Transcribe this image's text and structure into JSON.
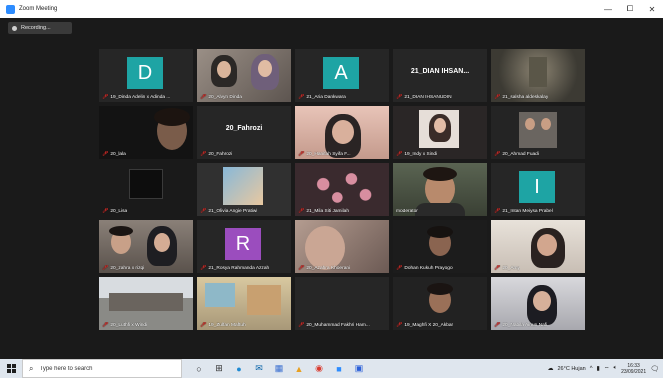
{
  "window": {
    "title": "Zoom Meeting",
    "controls": [
      "—",
      "⧠",
      "✕"
    ],
    "recording": "Recording..."
  },
  "colors": {
    "mic_muted": "#e0302c",
    "speaking_outline": "#c8d94a",
    "avatar_teal": "#1ea4a4",
    "avatar_purple": "#9b4dbe"
  },
  "participants": [
    {
      "label": "19_Dinda Adelin x Adinda ...",
      "avatar": "D",
      "kind": "avatar"
    },
    {
      "label": "20_Alvyn Dinda",
      "kind": "video"
    },
    {
      "label": "21_Aria Dankwara",
      "avatar": "A",
      "kind": "avatar"
    },
    {
      "label": "21_DIAN IHSANUDIN",
      "name": "21_DIAN IHSAN...",
      "kind": "name"
    },
    {
      "label": "21_salsha aldeskalay",
      "kind": "video"
    },
    {
      "label": "20_lala",
      "kind": "video"
    },
    {
      "label": "20_Fahrozi",
      "name": "20_Fahrozi",
      "kind": "name"
    },
    {
      "label": "20_Hanifah Syifa F...",
      "kind": "video"
    },
    {
      "label": "19_Indy x Sindi",
      "kind": "video"
    },
    {
      "label": "20_Ahmad Fuadi",
      "kind": "video"
    },
    {
      "label": "20_Lisa",
      "kind": "video"
    },
    {
      "label": "21_Olivia Angie Pratiwi",
      "kind": "video"
    },
    {
      "label": "21_Mila Siti Jamilah",
      "kind": "video"
    },
    {
      "label": "moderator",
      "kind": "video",
      "speaking": true
    },
    {
      "label": "21_Intan Meiysa Prabel",
      "avatar": "I",
      "kind": "avatar"
    },
    {
      "label": "20_zahra x rizqi",
      "kind": "video"
    },
    {
      "label": "21_Rosya Rahmanda Azzah",
      "avatar": "R",
      "kind": "avatar"
    },
    {
      "label": "20_Azahra Khoerani",
      "kind": "video"
    },
    {
      "label": "Dohan Kukuh Prayogo",
      "kind": "video"
    },
    {
      "label": "20_Amy",
      "kind": "video"
    },
    {
      "label": "20_Luthfi x Windi",
      "kind": "video"
    },
    {
      "label": "19_Zulfan Maftuh",
      "kind": "video"
    },
    {
      "label": "20_Muhammad Fakhri Ham...",
      "kind": "video"
    },
    {
      "label": "19_Maghfi X 20_Akbar",
      "kind": "video"
    },
    {
      "label": "20_Nabila Ainun Nafi",
      "kind": "video"
    }
  ],
  "taskbar": {
    "search_placeholder": "Type here to search",
    "weather": "26°C Hujan",
    "time": "16:33",
    "date": "23/09/2021",
    "app_icons": [
      "task-view-icon",
      "store-icon",
      "edge-icon",
      "mail-icon",
      "files-icon",
      "photos-icon",
      "chrome-icon",
      "zoom-icon",
      "camera-icon"
    ]
  }
}
